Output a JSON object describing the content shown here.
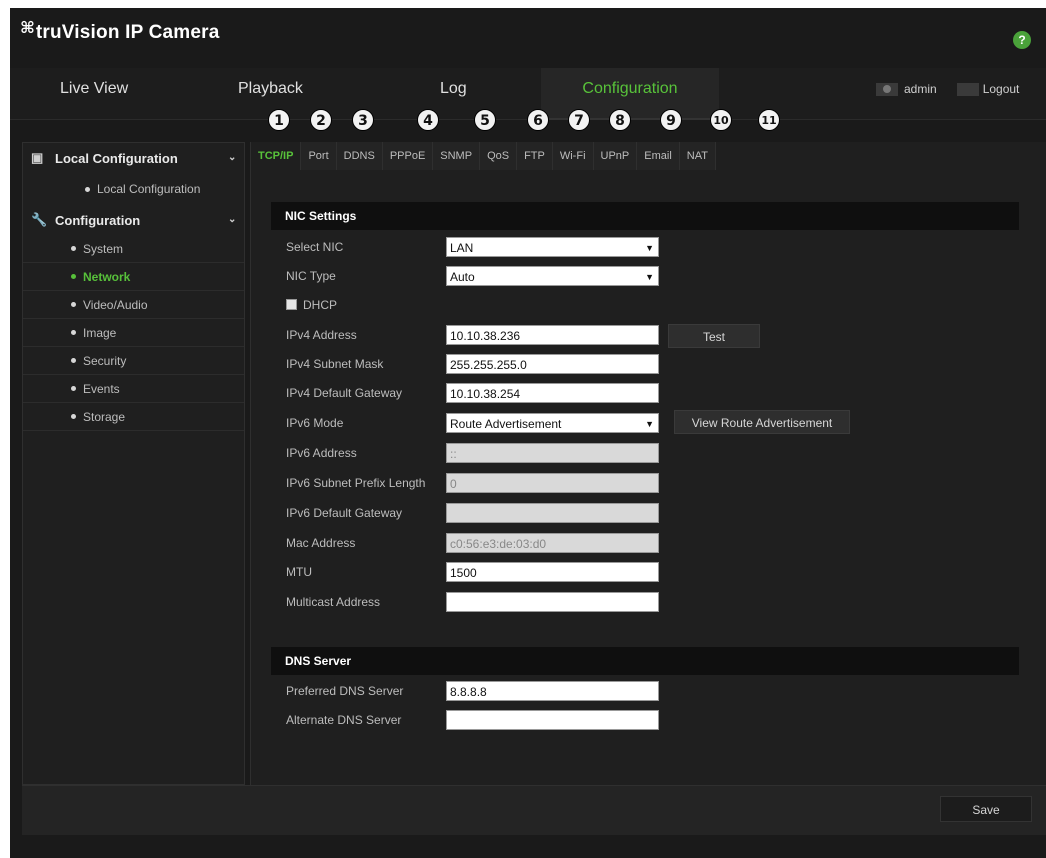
{
  "header": {
    "logo_mark": "⌘",
    "brand": "truVision IP Camera",
    "help_icon": "?"
  },
  "nav": {
    "tabs": [
      "Live View",
      "Playback",
      "Log",
      "Configuration"
    ],
    "active": "Configuration",
    "user": "admin",
    "logout": "Logout"
  },
  "callouts": [
    "1",
    "2",
    "3",
    "4",
    "5",
    "6",
    "7",
    "8",
    "9",
    "10",
    "11"
  ],
  "sidebar": {
    "local_group": "Local Configuration",
    "local_item": "Local Configuration",
    "config_group": "Configuration",
    "items": [
      "System",
      "Network",
      "Video/Audio",
      "Image",
      "Security",
      "Events",
      "Storage"
    ],
    "active_item": "Network"
  },
  "subtabs": [
    "TCP/IP",
    "Port",
    "DDNS",
    "PPPoE",
    "SNMP",
    "QoS",
    "FTP",
    "Wi-Fi",
    "UPnP",
    "Email",
    "NAT"
  ],
  "nic": {
    "section": "NIC Settings",
    "select_nic_label": "Select NIC",
    "select_nic_value": "LAN",
    "nic_type_label": "NIC Type",
    "nic_type_value": "Auto",
    "dhcp_label": "DHCP",
    "ipv4_label": "IPv4 Address",
    "ipv4_value": "10.10.38.236",
    "test_button": "Test",
    "mask_label": "IPv4 Subnet Mask",
    "mask_value": "255.255.255.0",
    "gateway_label": "IPv4 Default Gateway",
    "gateway_value": "10.10.38.254",
    "ipv6_mode_label": "IPv6 Mode",
    "ipv6_mode_value": "Route Advertisement",
    "view_route_button": "View Route Advertisement",
    "ipv6_addr_label": "IPv6 Address",
    "ipv6_addr_value": "::",
    "ipv6_prefix_label": "IPv6 Subnet Prefix Length",
    "ipv6_prefix_value": "0",
    "ipv6_gateway_label": "IPv6 Default Gateway",
    "ipv6_gateway_value": "",
    "mac_label": "Mac Address",
    "mac_value": "c0:56:e3:de:03:d0",
    "mtu_label": "MTU",
    "mtu_value": "1500",
    "multicast_label": "Multicast Address",
    "multicast_value": ""
  },
  "dns": {
    "section": "DNS Server",
    "preferred_label": "Preferred DNS Server",
    "preferred_value": "8.8.8.8",
    "alternate_label": "Alternate DNS Server",
    "alternate_value": ""
  },
  "footer": {
    "save": "Save"
  },
  "colors": {
    "accent": "#58c23a",
    "background": "#1a1a1a"
  }
}
